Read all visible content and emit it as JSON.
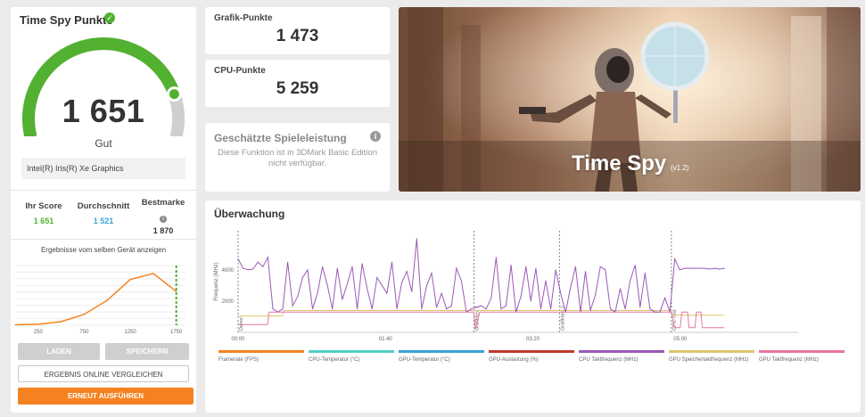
{
  "score_panel": {
    "title": "Time Spy Punkte",
    "score": "1 651",
    "rating": "Gut",
    "gpu": "Intel(R) Iris(R) Xe Graphics",
    "gauge_fraction": 0.84,
    "stats": [
      {
        "label": "Ihr Score",
        "value": "1 651",
        "color": "#52b130"
      },
      {
        "label": "Durchschnitt",
        "value": "1 521",
        "color": "#3aa0d8"
      },
      {
        "label": "Bestmarke",
        "value": "1 870",
        "color": "#333333"
      }
    ],
    "same_device_label": "Ergebnisse vom selben Gerät anzeigen",
    "buttons": {
      "load": "LADEN",
      "save": "SPEICHERN",
      "compare": "ERGEBNIS ONLINE VERGLEICHEN",
      "rerun": "ERNEUT AUSFÜHREN"
    }
  },
  "cards": {
    "graphics": {
      "title": "Grafik-Punkte",
      "value": "1 473"
    },
    "cpu": {
      "title": "CPU-Punkte",
      "value": "5 259"
    },
    "game": {
      "title": "Geschätzte Spieleleistung",
      "message": "Diese Funktion ist in 3DMark Basic Edition nicht verfügbar."
    }
  },
  "hero": {
    "title": "Time Spy",
    "version": "(v1.2)"
  },
  "monitor": {
    "title": "Überwachung"
  },
  "chart_data": [
    {
      "type": "area",
      "title": "",
      "xlabel": "",
      "ylabel": "",
      "x_ticks": [
        "250",
        "750",
        "1250",
        "1750"
      ],
      "marker_x": 1750,
      "x": [
        0,
        250,
        500,
        750,
        1000,
        1250,
        1500,
        1750
      ],
      "values": [
        0.2,
        0.5,
        1.8,
        5.5,
        12.5,
        23.0,
        26.0,
        17.0
      ],
      "colors": {
        "line": "#f58220",
        "marker": "#52b130"
      }
    },
    {
      "type": "line",
      "title": "",
      "ylabel": "Frequenz (MHz)",
      "y_ticks": [
        2000,
        4000
      ],
      "ylim": [
        0,
        6500
      ],
      "x_ticks": [
        "00:00",
        "01:40",
        "03:20",
        "05:00"
      ],
      "xlim": [
        0,
        380
      ],
      "markers": [
        {
          "t": 0,
          "label": "Demo"
        },
        {
          "t": 160,
          "label": "Grafiktest 1"
        },
        {
          "t": 218,
          "label": "Grafiktest 2"
        },
        {
          "t": 294,
          "label": "CPU-Test"
        }
      ],
      "series": [
        {
          "name": "Framerate (FPS)",
          "color": "#f58220",
          "values": []
        },
        {
          "name": "CPU-Temperatur (°C)",
          "color": "#4fd1c5",
          "values": []
        },
        {
          "name": "GPU-Temperatur (°C)",
          "color": "#3aa0d8",
          "values": []
        },
        {
          "name": "GPU-Auslastung (%)",
          "color": "#c0392b",
          "values": []
        },
        {
          "name": "CPU Taktfrequenz (MHz)",
          "color": "#9b59b6",
          "values": [
            4700,
            4100,
            4000,
            4050,
            4500,
            4200,
            4800,
            1500,
            1300,
            1500,
            4500,
            1700,
            2300,
            3500,
            4000,
            1500,
            2500,
            4200,
            3000,
            1500,
            4100,
            2100,
            3100,
            4200,
            1500,
            4400,
            2800,
            1500,
            3500,
            3000,
            2500,
            4500,
            1500,
            3200,
            3900,
            2600,
            6000,
            1500,
            3000,
            3800,
            1600,
            2500,
            1500,
            1700,
            4100,
            3300,
            1300,
            1500,
            1600,
            1700,
            1500,
            2200,
            4800,
            1500,
            1700,
            4300,
            1300,
            2300,
            4200,
            2000,
            4100,
            1500,
            3300,
            1500,
            4000,
            2500,
            1300,
            2900,
            4200,
            1300,
            3900,
            1400,
            2400,
            4200,
            4000,
            1500,
            1300,
            2800,
            1500,
            3300,
            4300,
            1600,
            3800,
            1500,
            1300,
            1300,
            2200,
            1300,
            4700,
            4000,
            4100,
            4100,
            4100,
            4100,
            4100,
            4050,
            4100,
            4050,
            4100
          ]
        },
        {
          "name": "GPU Speichertaktfrequenz (MHz)",
          "color": "#e0c56e",
          "values": []
        },
        {
          "name": "GPU Taktfrequenz (MHz)",
          "color": "#e877a0",
          "values": []
        }
      ]
    }
  ]
}
